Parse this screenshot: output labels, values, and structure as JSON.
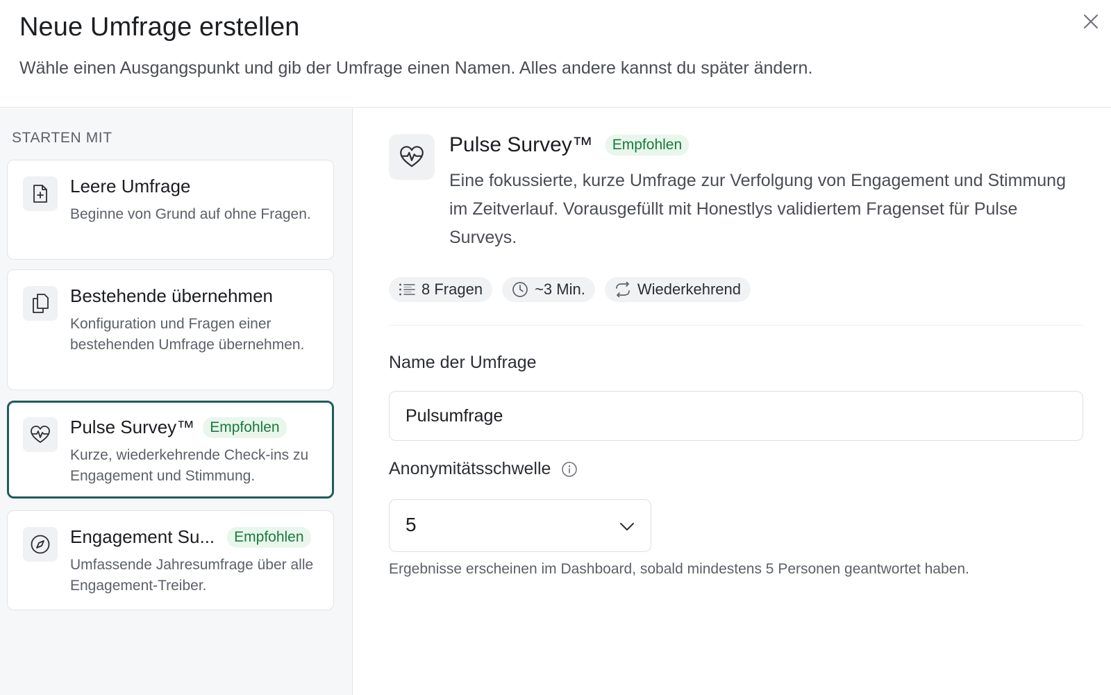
{
  "dialog": {
    "title": "Neue Umfrage erstellen",
    "subtitle": "Wähle einen Ausgangspunkt und gib der Umfrage einen Namen. Alles andere kannst du später ändern.",
    "close_icon": "close-icon"
  },
  "sidebar": {
    "title": "STARTEN MIT",
    "options": [
      {
        "icon": "file-plus-icon",
        "title": "Leere Umfrage",
        "badge": "",
        "description": "Beginne von Grund auf ohne Fragen.",
        "selected": false
      },
      {
        "icon": "copy-icon",
        "title": "Bestehende übernehmen",
        "badge": "",
        "description": "Konfiguration und Fragen einer bestehenden Umfrage übernehmen.",
        "selected": false
      },
      {
        "icon": "heart-pulse-icon",
        "title": "Pulse Survey™",
        "badge": "Empfohlen",
        "description": "Kurze, wiederkehrende Check-ins zu Engagement und Stimmung.",
        "selected": true
      },
      {
        "icon": "compass-icon",
        "title": "Engagement Su...",
        "badge": "Empfohlen",
        "description": "Umfassende Jahresumfrage über alle Engagement-Treiber.",
        "selected": false
      }
    ]
  },
  "detail": {
    "icon": "heart-pulse-icon",
    "title": "Pulse Survey™",
    "badge": "Empfohlen",
    "description": "Eine fokussierte, kurze Umfrage zur Verfolgung von Engagement und Stimmung im Zeitverlauf. Vorausgefüllt mit Honestlys validiertem Fragenset für Pulse Surveys.",
    "stats": [
      {
        "icon": "list-icon",
        "label": "8 Fragen"
      },
      {
        "icon": "clock-icon",
        "label": "~3 Min."
      },
      {
        "icon": "repeat-icon",
        "label": "Wiederkehrend"
      }
    ]
  },
  "form": {
    "name_label": "Name der Umfrage",
    "name_value": "Pulsumfrage",
    "threshold_label": "Anonymitätsschwelle",
    "threshold_value": "5",
    "threshold_hint": "Ergebnisse erscheinen im Dashboard, sobald mindestens 5 Personen geantwortet haben."
  },
  "colors": {
    "accent": "#1e5c5a",
    "badge_bg": "#e9f6ec",
    "badge_text": "#177a3a",
    "sidebar_bg": "#f6f7f8"
  }
}
